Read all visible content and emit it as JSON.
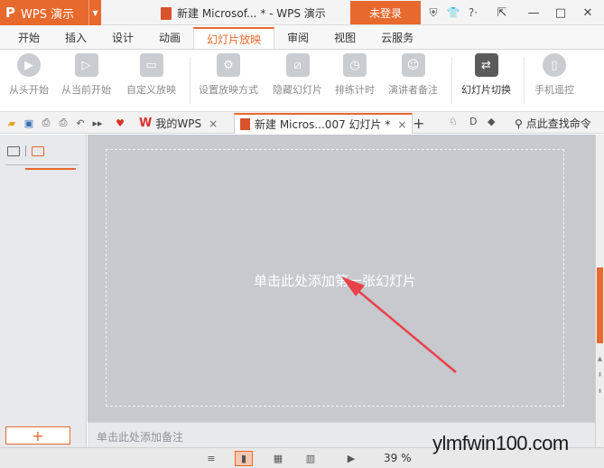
{
  "titlebar": {
    "app_name": "WPS 演示",
    "app_logo": "P",
    "doc_title": "新建 Microsof... * - WPS 演示",
    "login_label": "未登录",
    "icons": [
      "shield-icon",
      "shirt-icon",
      "help-icon",
      "ribbon-toggle-icon"
    ],
    "help_glyph": "?·",
    "window": {
      "minimize": "—",
      "maximize": "□",
      "close": "✕"
    }
  },
  "menu": {
    "tabs": [
      "开始",
      "插入",
      "设计",
      "动画",
      "幻灯片放映",
      "审阅",
      "视图",
      "云服务"
    ],
    "active": "幻灯片放映"
  },
  "ribbon": {
    "buttons": [
      {
        "id": "from-start",
        "label": "从头开始"
      },
      {
        "id": "from-current",
        "label": "从当前开始"
      },
      {
        "id": "custom-show",
        "label": "自定义放映"
      },
      {
        "id": "setup-show",
        "label": "设置放映方式"
      },
      {
        "id": "hide-slide",
        "label": "隐藏幻灯片"
      },
      {
        "id": "rehearse",
        "label": "排练计时"
      },
      {
        "id": "presenter-notes",
        "label": "演讲者备注"
      },
      {
        "id": "slide-switch",
        "label": "幻灯片切换"
      },
      {
        "id": "phone-remote",
        "label": "手机遥控"
      }
    ]
  },
  "doctabs": {
    "tabs": [
      {
        "label": "我的WPS",
        "active": false
      },
      {
        "label": "新建 Micros...007 幻灯片 *",
        "active": true
      }
    ],
    "close_glyph": "×",
    "add_glyph": "+",
    "search_command": "点此查找命令"
  },
  "slide": {
    "placeholder": "单击此处添加第一张幻灯片",
    "notes_placeholder": "单击此处添加备注"
  },
  "leftpane": {
    "add_glyph": "+"
  },
  "statusbar": {
    "zoom": "39 %"
  },
  "watermark": "ylmfwin100.com",
  "colors": {
    "accent": "#e8692d",
    "arrow": "#e8424a",
    "canvas": "#c7c9cf"
  }
}
